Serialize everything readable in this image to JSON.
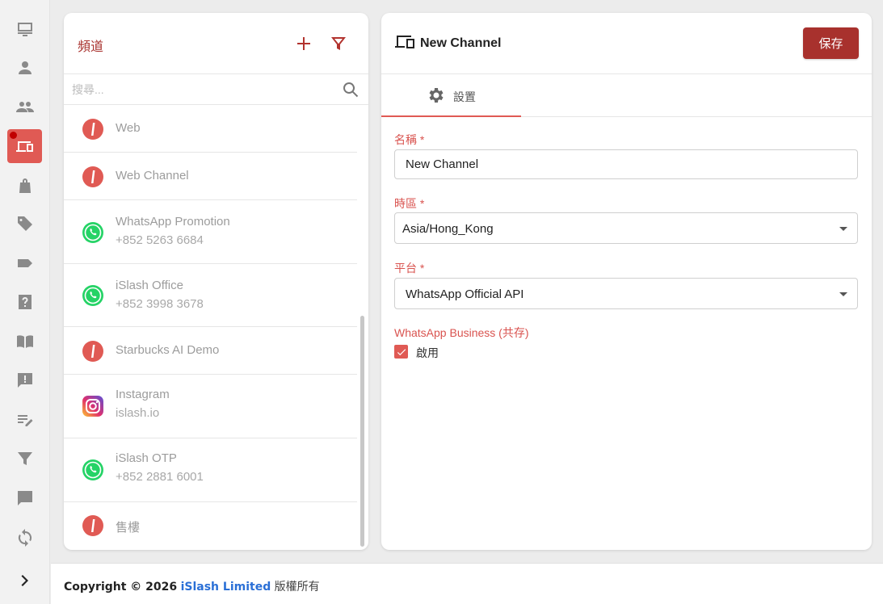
{
  "sidebar": {
    "items": [
      {
        "icon": "inbox-icon"
      },
      {
        "icon": "user-icon"
      },
      {
        "icon": "group-icon"
      },
      {
        "icon": "devices-icon",
        "active": true,
        "badge": true
      },
      {
        "icon": "shopping-bag-icon"
      },
      {
        "icon": "tags-icon"
      },
      {
        "icon": "label-icon"
      },
      {
        "icon": "help-icon"
      },
      {
        "icon": "book-icon"
      },
      {
        "icon": "feedback-icon"
      },
      {
        "icon": "edit-note-icon"
      },
      {
        "icon": "filter-icon"
      },
      {
        "icon": "chat-icon"
      },
      {
        "icon": "sync-icon"
      },
      {
        "icon": "chevron-right-icon"
      }
    ]
  },
  "channels": {
    "title": "頻道",
    "search_placeholder": "搜尋...",
    "items": [
      {
        "title": "Web",
        "subtitle": "",
        "platform": "islash"
      },
      {
        "title": "Web Channel",
        "subtitle": "",
        "platform": "islash"
      },
      {
        "title": "WhatsApp Promotion",
        "subtitle": "+852 5263 6684",
        "platform": "whatsapp"
      },
      {
        "title": "iSlash Office",
        "subtitle": "+852 3998 3678",
        "platform": "whatsapp"
      },
      {
        "title": "Starbucks AI Demo",
        "subtitle": "",
        "platform": "islash"
      },
      {
        "title": "Instagram",
        "subtitle": "islash.io",
        "platform": "instagram"
      },
      {
        "title": "iSlash OTP",
        "subtitle": "+852 2881 6001",
        "platform": "whatsapp"
      },
      {
        "title": "售樓",
        "subtitle": "",
        "platform": "islash"
      }
    ]
  },
  "detail": {
    "title": "New Channel",
    "save_label": "保存",
    "tab_settings": "設置",
    "name_label": "名稱 *",
    "name_value": "New Channel",
    "timezone_label": "時區 *",
    "timezone_value": "Asia/Hong_Kong",
    "platform_label": "平台 *",
    "platform_value": "WhatsApp Official API",
    "business_label": "WhatsApp Business (共存)",
    "enable_label": "啟用",
    "enable_checked": true
  },
  "footer": {
    "copyright": "Copyright © 2026",
    "company": "iSlash Limited",
    "rights": "版權所有"
  },
  "colors": {
    "accent": "#e05a54",
    "brand_dark": "#a8312d",
    "whatsapp": "#25d366",
    "link": "#2a6fd6"
  }
}
